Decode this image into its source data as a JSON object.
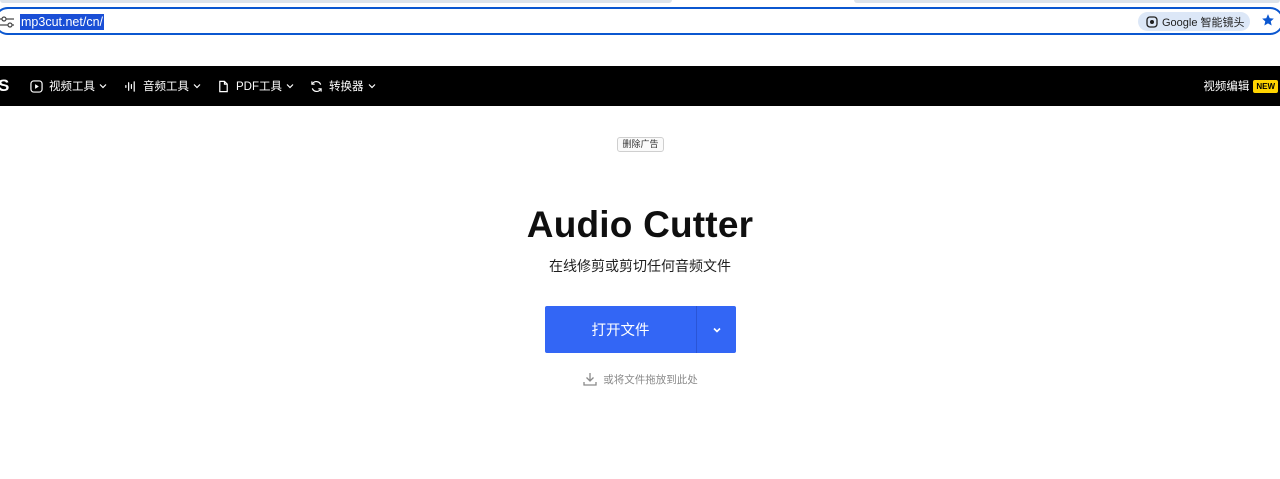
{
  "browser": {
    "url": "mp3cut.net/cn/",
    "lens_label": "Google 智能镜头"
  },
  "nav": {
    "logo_fragment": "S",
    "items": [
      {
        "label": "视频工具",
        "icon": "play-square-icon"
      },
      {
        "label": "音频工具",
        "icon": "waveform-icon"
      },
      {
        "label": "PDF工具",
        "icon": "document-icon"
      },
      {
        "label": "转换器",
        "icon": "convert-icon"
      }
    ],
    "right_label": "视频编辑",
    "new_badge": "NEW"
  },
  "main": {
    "remove_ads": "删除广告",
    "title": "Audio Cutter",
    "subtitle": "在线修剪或剪切任何音频文件",
    "open_button": "打开文件",
    "drop_hint": "或将文件拖放到此处"
  },
  "colors": {
    "accent": "#3366f5",
    "nav_bg": "#000000",
    "badge": "#ffd400",
    "omnibox_border": "#0b57d0"
  }
}
